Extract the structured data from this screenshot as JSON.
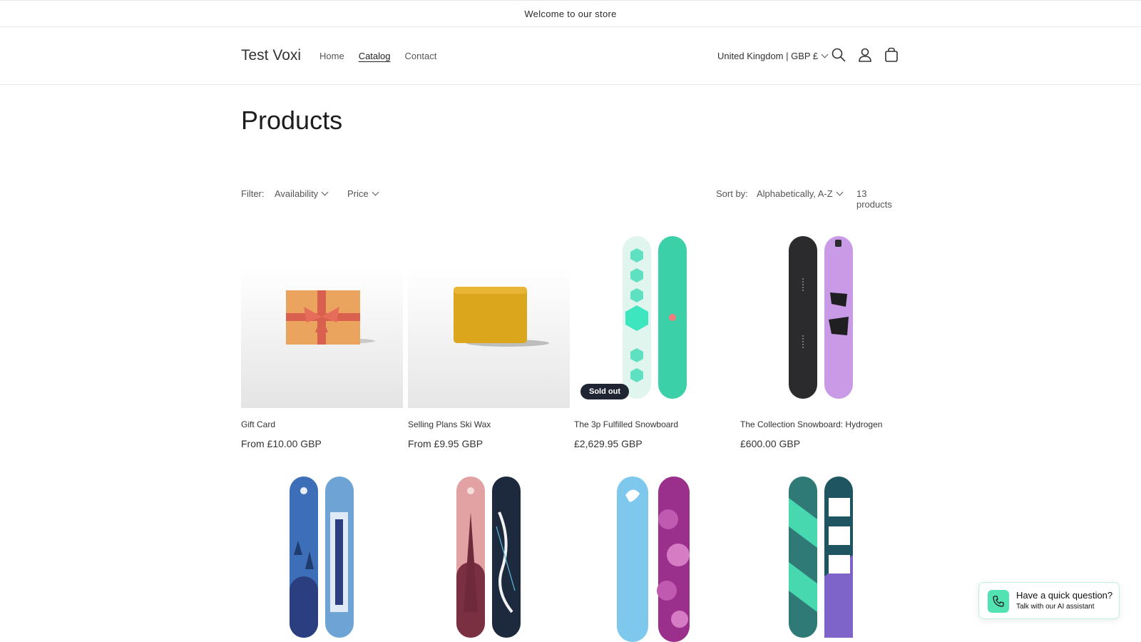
{
  "announcement": "Welcome to our store",
  "header": {
    "logo": "Test Voxi",
    "nav": [
      "Home",
      "Catalog",
      "Contact"
    ],
    "active_nav": "Catalog",
    "country": "United Kingdom | GBP £",
    "icons": [
      "search-icon",
      "account-icon",
      "cart-icon"
    ]
  },
  "page_title": "Products",
  "filters": {
    "label": "Filter:",
    "availability": "Availability",
    "price": "Price",
    "sort_label": "Sort by:",
    "sort_value": "Alphabetically, A-Z",
    "count": "13 products"
  },
  "products": [
    {
      "name": "Gift Card",
      "price": "From £10.00 GBP",
      "badge": ""
    },
    {
      "name": "Selling Plans Ski Wax",
      "price": "From £9.95 GBP",
      "badge": ""
    },
    {
      "name": "The 3p Fulfilled Snowboard",
      "price": "£2,629.95 GBP",
      "badge": "Sold out"
    },
    {
      "name": "The Collection Snowboard: Hydrogen",
      "price": "£600.00 GBP",
      "badge": ""
    },
    {
      "name": "",
      "price": "",
      "badge": ""
    },
    {
      "name": "",
      "price": "",
      "badge": ""
    },
    {
      "name": "",
      "price": "",
      "badge": ""
    },
    {
      "name": "",
      "price": "",
      "badge": ""
    }
  ],
  "chat_widget": {
    "title": "Have a quick question?",
    "subtitle": "Talk with our AI assistant",
    "accent": "#53e3b3"
  }
}
